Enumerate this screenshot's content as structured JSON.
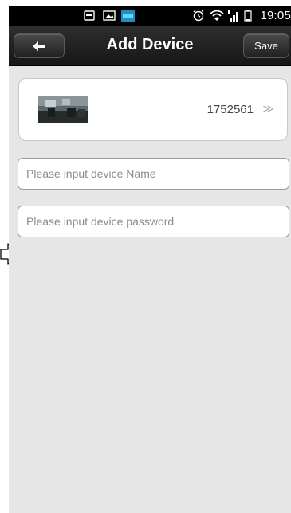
{
  "status_bar": {
    "time": "19:05",
    "icons": [
      "mail-icon",
      "image-icon",
      "app-icon",
      "alarm-icon",
      "wifi-icon",
      "signal-icon",
      "battery-icon"
    ]
  },
  "header": {
    "title": "Add Device",
    "back_icon": "back-arrow-icon",
    "save_label": "Save"
  },
  "device": {
    "id": "1752561",
    "chevron": "≫"
  },
  "form": {
    "name_placeholder": "Please input device Name",
    "name_value": "",
    "password_placeholder": "Please input device password",
    "password_value": ""
  },
  "colors": {
    "header_bg": "#1e1e1e",
    "screen_bg": "#e6e6e6",
    "card_bg": "#ffffff"
  }
}
